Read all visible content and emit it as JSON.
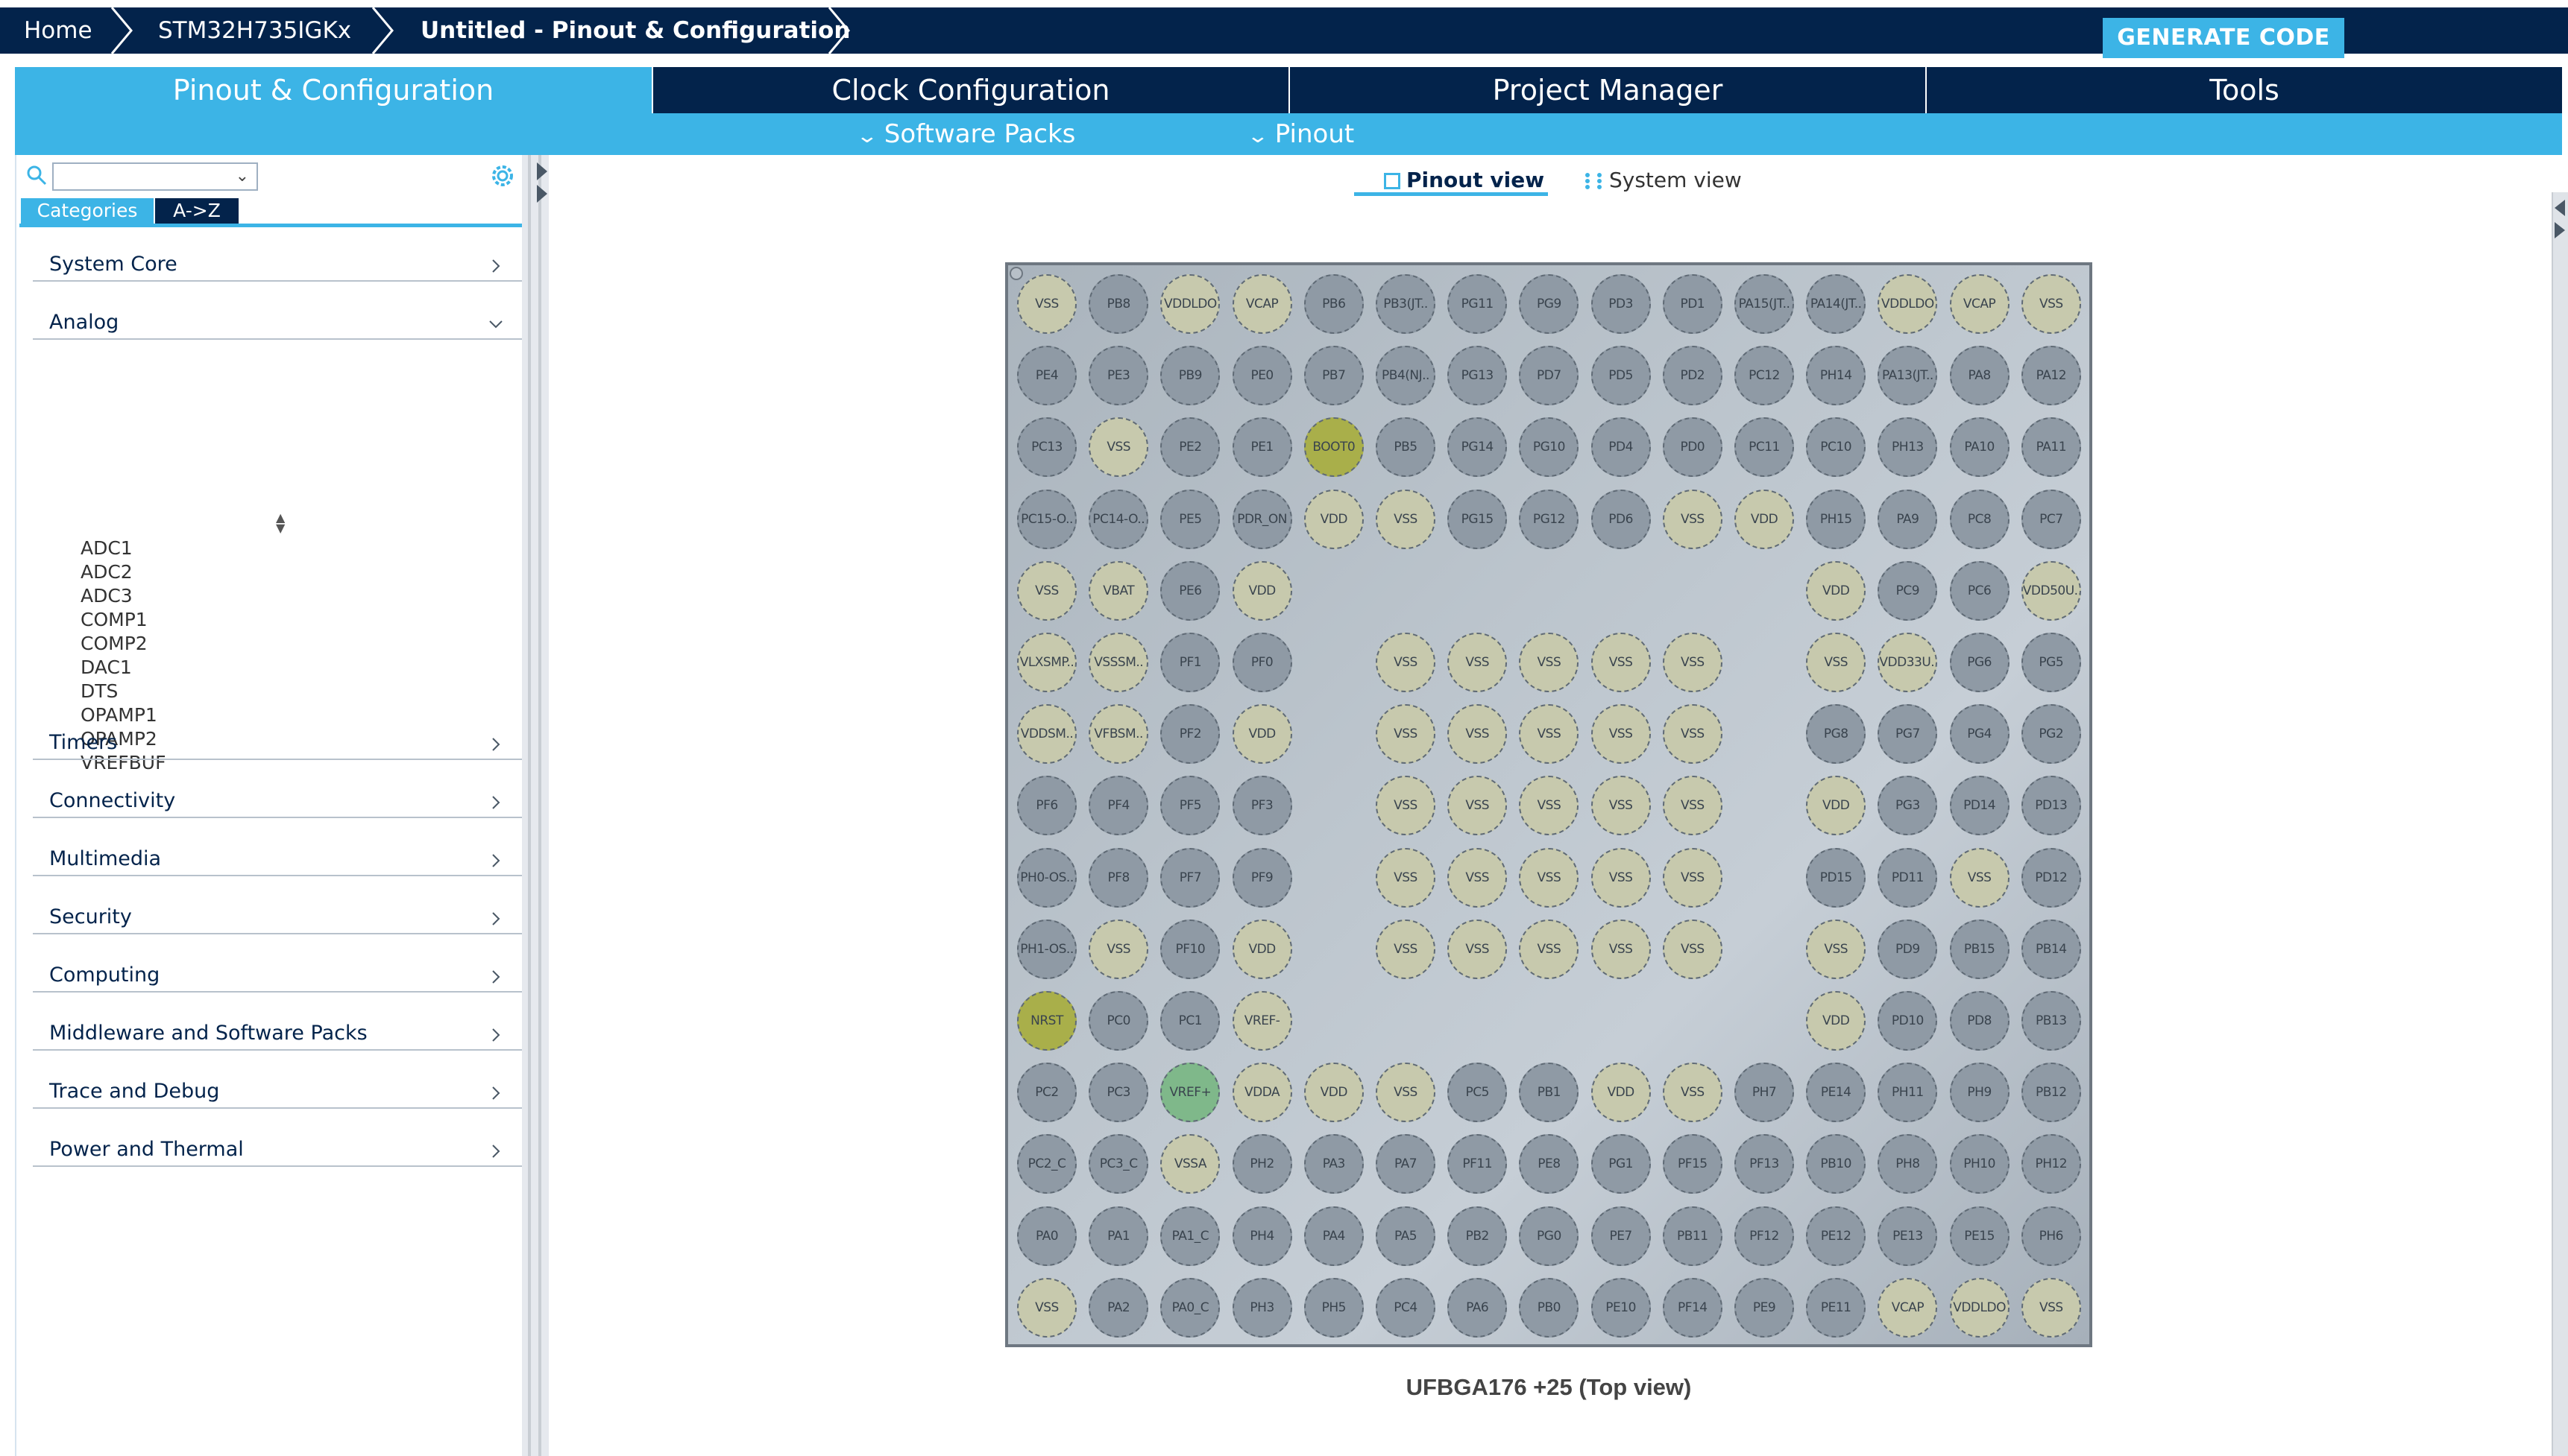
{
  "breadcrumbs": [
    "Home",
    "STM32H735IGKx",
    "Untitled - Pinout & Configuration"
  ],
  "generate_code_label": "GENERATE CODE",
  "tabs": [
    "Pinout & Configuration",
    "Clock Configuration",
    "Project Manager",
    "Tools"
  ],
  "subbar": [
    "Software Packs",
    "Pinout"
  ],
  "sidebar": {
    "search_placeholder": "",
    "category_tabs": [
      "Categories",
      "A->Z"
    ],
    "categories": [
      {
        "label": "System Core",
        "expanded": false
      },
      {
        "label": "Analog",
        "expanded": true,
        "items": [
          "ADC1",
          "ADC2",
          "ADC3",
          "COMP1",
          "COMP2",
          "DAC1",
          "DTS",
          "OPAMP1",
          "OPAMP2",
          "VREFBUF"
        ]
      },
      {
        "label": "Timers",
        "expanded": false
      },
      {
        "label": "Connectivity",
        "expanded": false
      },
      {
        "label": "Multimedia",
        "expanded": false
      },
      {
        "label": "Security",
        "expanded": false
      },
      {
        "label": "Computing",
        "expanded": false
      },
      {
        "label": "Middleware and Software Packs",
        "expanded": false
      },
      {
        "label": "Trace and Debug",
        "expanded": false
      },
      {
        "label": "Power and Thermal",
        "expanded": false
      }
    ]
  },
  "view_tabs": [
    "Pinout view",
    "System view"
  ],
  "package_label": "UFBGA176 +25 (Top view)",
  "colors": {
    "navy": "#03234b",
    "accent": "#3cb4e6",
    "gpio": "#8f9aa5",
    "power": "#c7c9ad",
    "special": "#a9af4a",
    "analog": "#7fb88a"
  },
  "pin_grid": [
    [
      "VSS",
      "PB8",
      "VDDLDO",
      "VCAP",
      "PB6",
      "PB3(JT..",
      "PG11",
      "PG9",
      "PD3",
      "PD1",
      "PA15(JT..",
      "PA14(JT..",
      "VDDLDO",
      "VCAP",
      "VSS"
    ],
    [
      "PE4",
      "PE3",
      "PB9",
      "PE0",
      "PB7",
      "PB4(NJ..",
      "PG13",
      "PD7",
      "PD5",
      "PD2",
      "PC12",
      "PH14",
      "PA13(JT..",
      "PA8",
      "PA12"
    ],
    [
      "PC13",
      "VSS",
      "PE2",
      "PE1",
      "BOOT0",
      "PB5",
      "PG14",
      "PG10",
      "PD4",
      "PD0",
      "PC11",
      "PC10",
      "PH13",
      "PA10",
      "PA11"
    ],
    [
      "PC15-O..",
      "PC14-O..",
      "PE5",
      "PDR_ON",
      "VDD",
      "VSS",
      "PG15",
      "PG12",
      "PD6",
      "VSS",
      "VDD",
      "PH15",
      "PA9",
      "PC8",
      "PC7"
    ],
    [
      "VSS",
      "VBAT",
      "PE6",
      "VDD",
      "",
      "",
      "",
      "",
      "",
      "",
      "",
      "VDD",
      "PC9",
      "PC6",
      "VDD50U.."
    ],
    [
      "VLXSMP..",
      "VSSSM..",
      "PF1",
      "PF0",
      "",
      "VSS",
      "VSS",
      "VSS",
      "VSS",
      "VSS",
      "",
      "VSS",
      "VDD33U..",
      "PG6",
      "PG5"
    ],
    [
      "VDDSM..",
      "VFBSM..",
      "PF2",
      "VDD",
      "",
      "VSS",
      "VSS",
      "VSS",
      "VSS",
      "VSS",
      "",
      "PG8",
      "PG7",
      "PG4",
      "PG2"
    ],
    [
      "PF6",
      "PF4",
      "PF5",
      "PF3",
      "",
      "VSS",
      "VSS",
      "VSS",
      "VSS",
      "VSS",
      "",
      "VDD",
      "PG3",
      "PD14",
      "PD13"
    ],
    [
      "PH0-OS..",
      "PF8",
      "PF7",
      "PF9",
      "",
      "VSS",
      "VSS",
      "VSS",
      "VSS",
      "VSS",
      "",
      "PD15",
      "PD11",
      "VSS",
      "PD12"
    ],
    [
      "PH1-OS..",
      "VSS",
      "PF10",
      "VDD",
      "",
      "VSS",
      "VSS",
      "VSS",
      "VSS",
      "VSS",
      "",
      "VSS",
      "PD9",
      "PB15",
      "PB14"
    ],
    [
      "NRST",
      "PC0",
      "PC1",
      "VREF-",
      "",
      "",
      "",
      "",
      "",
      "",
      "",
      "VDD",
      "PD10",
      "PD8",
      "PB13"
    ],
    [
      "PC2",
      "PC3",
      "VREF+",
      "VDDA",
      "VDD",
      "VSS",
      "PC5",
      "PB1",
      "VDD",
      "VSS",
      "PH7",
      "PE14",
      "PH11",
      "PH9",
      "PB12"
    ],
    [
      "PC2_C",
      "PC3_C",
      "VSSA",
      "PH2",
      "PA3",
      "PA7",
      "PF11",
      "PE8",
      "PG1",
      "PF15",
      "PF13",
      "PB10",
      "PH8",
      "PH10",
      "PH12"
    ],
    [
      "PA0",
      "PA1",
      "PA1_C",
      "PH4",
      "PA4",
      "PA5",
      "PB2",
      "PG0",
      "PE7",
      "PB11",
      "PF12",
      "PE12",
      "PE13",
      "PE15",
      "PH6"
    ],
    [
      "VSS",
      "PA2",
      "PA0_C",
      "PH3",
      "PH5",
      "PC4",
      "PA6",
      "PB0",
      "PE10",
      "PF14",
      "PE9",
      "PE11",
      "VCAP",
      "VDDLDO",
      "VSS"
    ]
  ]
}
